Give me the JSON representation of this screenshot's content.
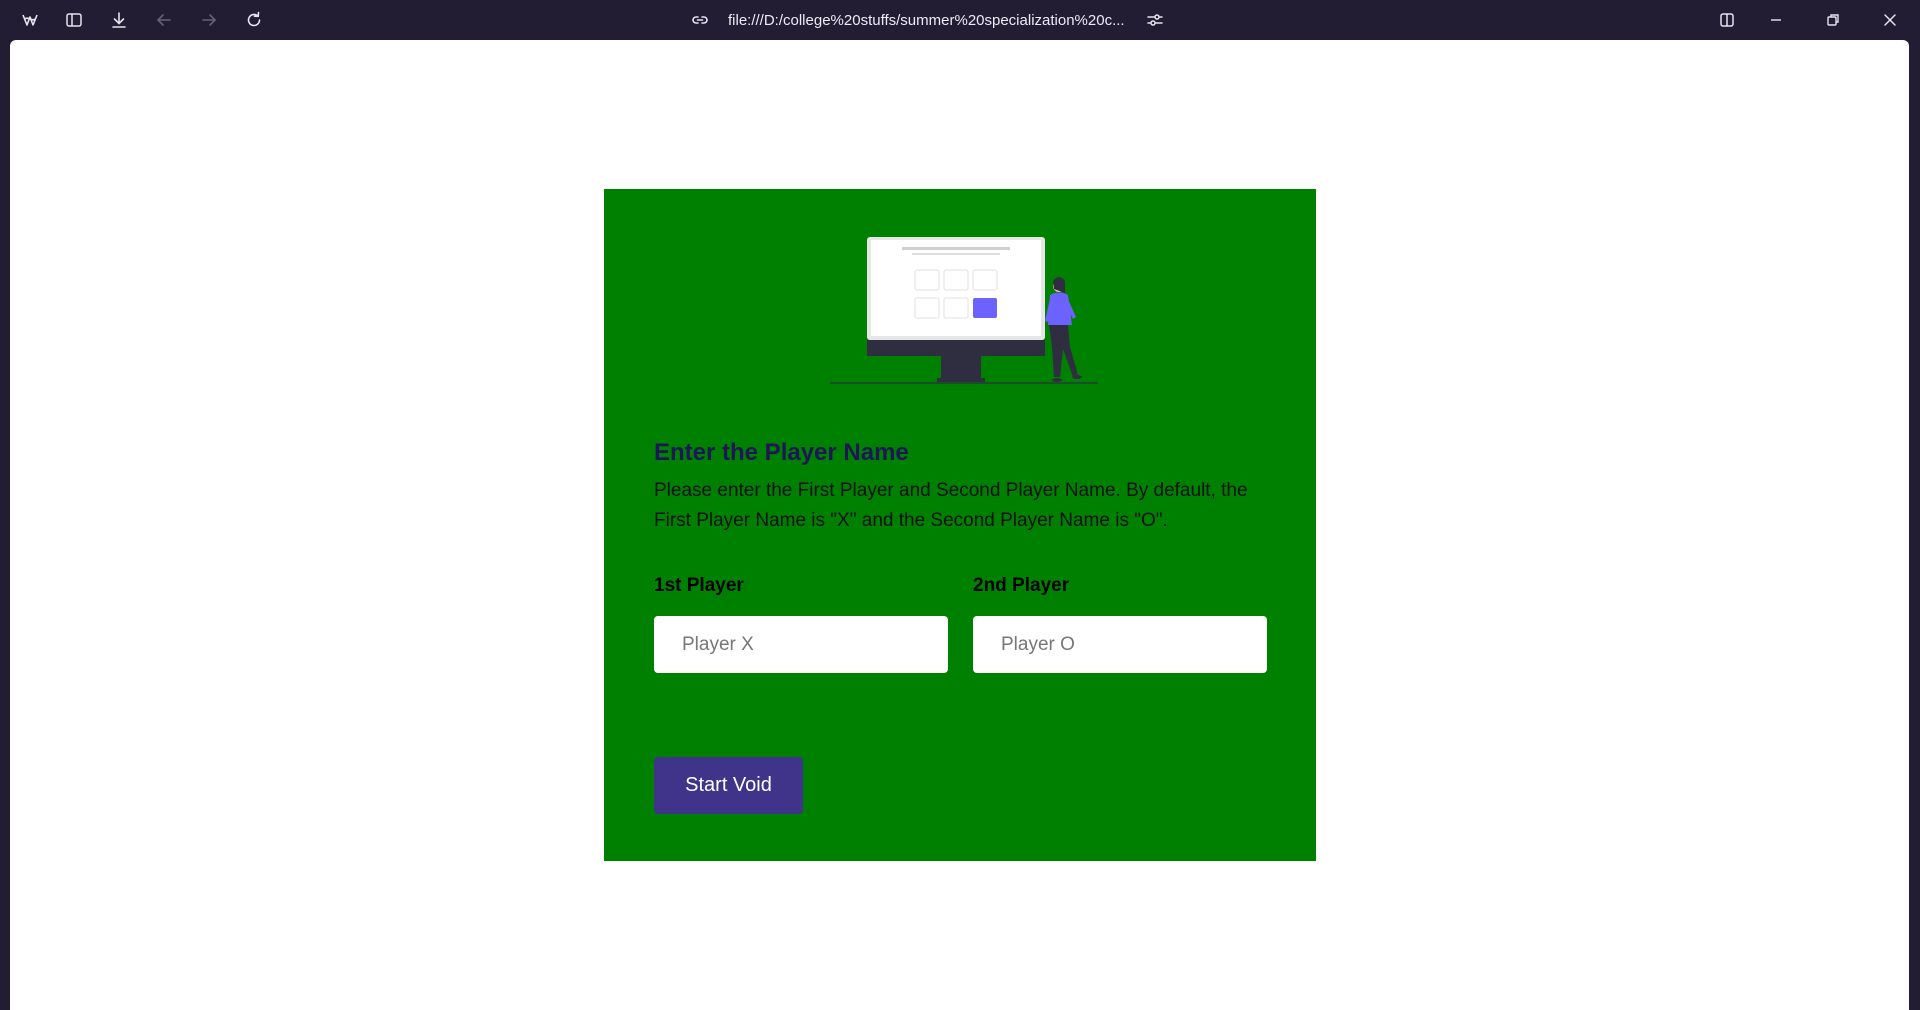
{
  "browser": {
    "url": "file:///D:/college%20stuffs/summer%20specialization%20c..."
  },
  "page": {
    "title": "Enter the Player Name",
    "description": "Please enter the First Player and Second Player Name. By default, the First Player Name is \"X\" and the Second Player Name is \"O\".",
    "player1": {
      "label": "1st Player",
      "placeholder": "Player X"
    },
    "player2": {
      "label": "2nd Player",
      "placeholder": "Player O"
    },
    "start_button": "Start Void"
  },
  "colors": {
    "card_background": "#008000",
    "title": "#1e1656",
    "button": "#3f3489",
    "accent_tile": "#6c63ff"
  },
  "icons": {
    "toolbar": [
      "app-logo-icon",
      "sidebar-icon",
      "download-icon",
      "back-icon",
      "forward-icon",
      "reload-icon"
    ],
    "address": [
      "link-icon",
      "site-settings-icon"
    ],
    "window": [
      "split-view-icon",
      "minimize-icon",
      "restore-icon",
      "close-icon"
    ]
  }
}
